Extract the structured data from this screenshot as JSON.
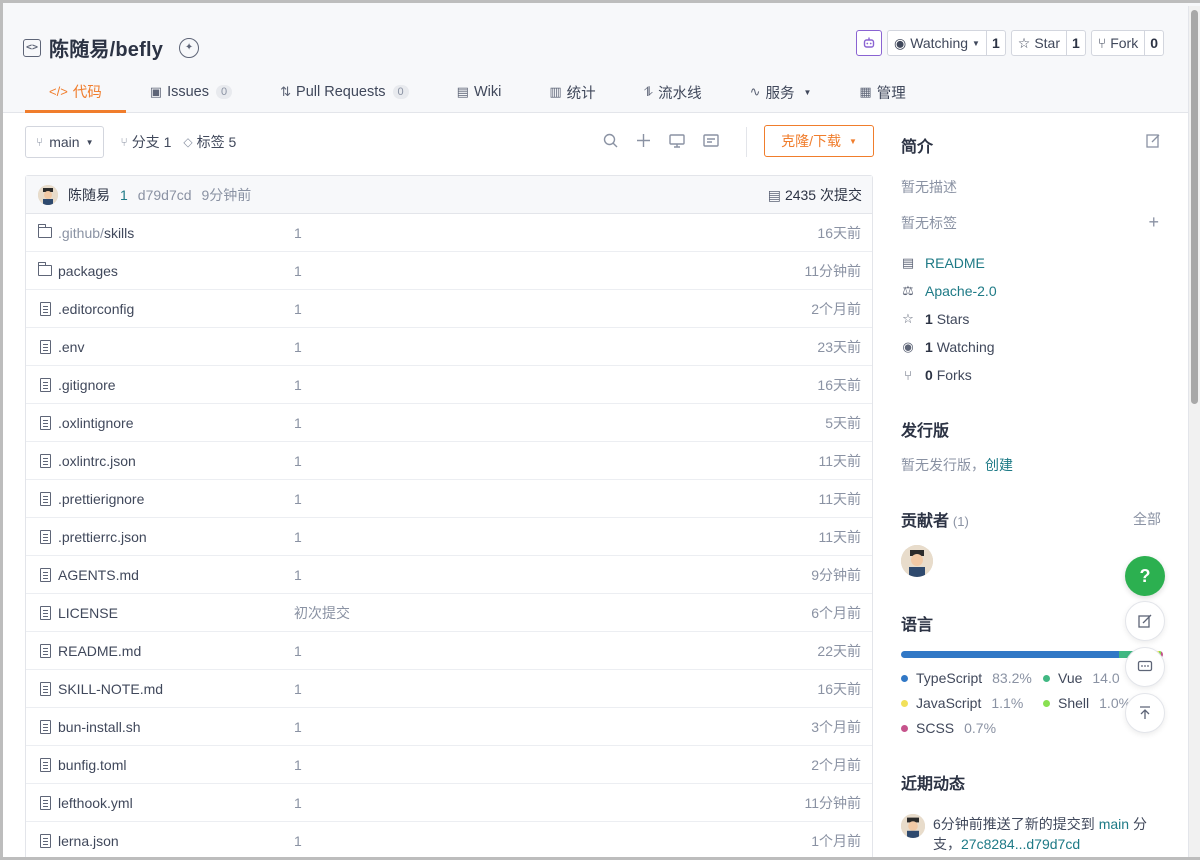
{
  "repo": {
    "title": "陈随易/befly"
  },
  "actions": {
    "watch_label": "Watching",
    "watch_count": "1",
    "star_label": "Star",
    "star_count": "1",
    "fork_label": "Fork",
    "fork_count": "0"
  },
  "tabs": [
    {
      "label": "代码",
      "icon": "code-icon"
    },
    {
      "label": "Issues",
      "count": "0",
      "icon": "issues-icon"
    },
    {
      "label": "Pull Requests",
      "count": "0",
      "icon": "pull-request-icon"
    },
    {
      "label": "Wiki",
      "icon": "book-icon"
    },
    {
      "label": "统计",
      "icon": "bar-chart-icon"
    },
    {
      "label": "流水线",
      "icon": "pipeline-icon"
    },
    {
      "label": "服务",
      "icon": "pulse-icon"
    },
    {
      "label": "管理",
      "icon": "settings-doc-icon"
    }
  ],
  "toolbar": {
    "branch": "main",
    "branches_label": "分支 1",
    "tags_label": "标签 5",
    "clone_label": "克隆/下载"
  },
  "commit": {
    "author": "陈随易",
    "count": "1",
    "hash": "d79d7cd",
    "time": "9分钟前",
    "total": "2435 次提交"
  },
  "files": [
    {
      "type": "folder",
      "name_dim": ".github/",
      "name": "skills",
      "msg": "1",
      "time": "16天前"
    },
    {
      "type": "folder",
      "name_dim": "",
      "name": "packages",
      "msg": "1",
      "time": "11分钟前"
    },
    {
      "type": "file",
      "name_dim": "",
      "name": ".editorconfig",
      "msg": "1",
      "time": "2个月前"
    },
    {
      "type": "file",
      "name_dim": "",
      "name": ".env",
      "msg": "1",
      "time": "23天前"
    },
    {
      "type": "file",
      "name_dim": "",
      "name": ".gitignore",
      "msg": "1",
      "time": "16天前"
    },
    {
      "type": "file",
      "name_dim": "",
      "name": ".oxlintignore",
      "msg": "1",
      "time": "5天前"
    },
    {
      "type": "file",
      "name_dim": "",
      "name": ".oxlintrc.json",
      "msg": "1",
      "time": "11天前"
    },
    {
      "type": "file",
      "name_dim": "",
      "name": ".prettierignore",
      "msg": "1",
      "time": "11天前"
    },
    {
      "type": "file",
      "name_dim": "",
      "name": ".prettierrc.json",
      "msg": "1",
      "time": "11天前"
    },
    {
      "type": "file",
      "name_dim": "",
      "name": "AGENTS.md",
      "msg": "1",
      "time": "9分钟前"
    },
    {
      "type": "file",
      "name_dim": "",
      "name": "LICENSE",
      "msg": "初次提交",
      "time": "6个月前"
    },
    {
      "type": "file",
      "name_dim": "",
      "name": "README.md",
      "msg": "1",
      "time": "22天前"
    },
    {
      "type": "file",
      "name_dim": "",
      "name": "SKILL-NOTE.md",
      "msg": "1",
      "time": "16天前"
    },
    {
      "type": "file",
      "name_dim": "",
      "name": "bun-install.sh",
      "msg": "1",
      "time": "3个月前"
    },
    {
      "type": "file",
      "name_dim": "",
      "name": "bunfig.toml",
      "msg": "1",
      "time": "2个月前"
    },
    {
      "type": "file",
      "name_dim": "",
      "name": "lefthook.yml",
      "msg": "1",
      "time": "11分钟前"
    },
    {
      "type": "file",
      "name_dim": "",
      "name": "lerna.json",
      "msg": "1",
      "time": "1个月前"
    }
  ],
  "sidebar": {
    "intro_title": "简介",
    "no_desc": "暂无描述",
    "no_tags": "暂无标签",
    "readme": "README",
    "license": "Apache-2.0",
    "stars_count": "1",
    "stars_label": "Stars",
    "watching_count": "1",
    "watching_label": "Watching",
    "forks_count": "0",
    "forks_label": "Forks",
    "release_title": "发行版",
    "no_release": "暂无发行版，",
    "create_link": "创建",
    "contrib_title": "贡献者",
    "contrib_count": "(1)",
    "all_link": "全部",
    "lang_title": "语言",
    "activity_title": "近期动态",
    "activity_text": "6分钟前推送了新的提交到",
    "activity_branch": "main",
    "activity_suffix": "分",
    "activity_line2_prefix": "支，",
    "activity_range": "27c8284...d79d7cd"
  },
  "languages": [
    {
      "name": "TypeScript",
      "pct": "83.2%",
      "value": 83.2,
      "color": "#3178c6"
    },
    {
      "name": "Vue",
      "pct": "14.0",
      "value": 14.0,
      "color": "#41b883"
    },
    {
      "name": "JavaScript",
      "pct": "1.1%",
      "value": 1.1,
      "color": "#f1e05a"
    },
    {
      "name": "Shell",
      "pct": "1.0%",
      "value": 1.0,
      "color": "#89e051"
    },
    {
      "name": "SCSS",
      "pct": "0.7%",
      "value": 0.7,
      "color": "#c6538c"
    }
  ],
  "floating": {
    "help": "?"
  },
  "colors": {
    "accent": "#f07d2c",
    "link": "#1e7a86",
    "help_button": "#2cb050"
  }
}
